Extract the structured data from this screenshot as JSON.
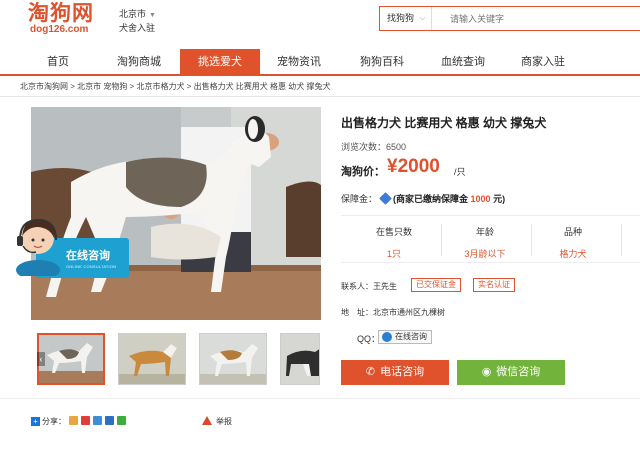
{
  "header": {
    "logo_text": "淘狗网",
    "logo_domain": "dog126.com",
    "city": "北京市",
    "merchant_join": "犬舍入驻",
    "search_category": "找狗狗",
    "search_placeholder": "请输入关键字"
  },
  "nav": {
    "items": [
      {
        "label": "首页"
      },
      {
        "label": "淘狗商城"
      },
      {
        "label": "挑选爱犬"
      },
      {
        "label": "宠物资讯"
      },
      {
        "label": "狗狗百科"
      },
      {
        "label": "血统查询"
      },
      {
        "label": "商家入驻"
      }
    ],
    "active_index": 2
  },
  "breadcrumb": "北京市淘狗网 > 北京市 宠物狗 > 北京市格力犬 > 出售格力犬 比赛用犬 格惠 幼犬 撑兔犬",
  "consult_widget": {
    "title": "在线咨询",
    "subtitle": "ONLINE CONSULTATION"
  },
  "listing": {
    "title": "出售格力犬 比赛用犬 格惠 幼犬 撑兔犬",
    "views_label": "浏览次数：",
    "views": "6500",
    "price_label": "淘狗价：",
    "price": "¥2000",
    "price_unit": "/只",
    "guarantee_label": "保障金：",
    "guarantee_text": "(商家已缴纳保障金",
    "guarantee_amount": "1000",
    "guarantee_suffix": "元)",
    "specs": [
      {
        "key": "在售只数",
        "value": "1只"
      },
      {
        "key": "年龄",
        "value": "3月龄以下"
      },
      {
        "key": "品种",
        "value": "格力犬"
      }
    ],
    "contact_label": "联系人：",
    "contact_name": "王先生",
    "badges": [
      "已交保证金",
      "实名认证"
    ],
    "address_label": "地　址：",
    "address": "北京市通州区九棵树",
    "qq_label": "QQ：",
    "qq_button": "在线咨询",
    "phone_button": "电话咨询",
    "wechat_button": "微信咨询"
  },
  "footer": {
    "share_label": "分享：",
    "report_label": "举报"
  },
  "colors": {
    "brand": "#e0522c",
    "wechat": "#72b33b",
    "consult": "#1ea0d0"
  }
}
